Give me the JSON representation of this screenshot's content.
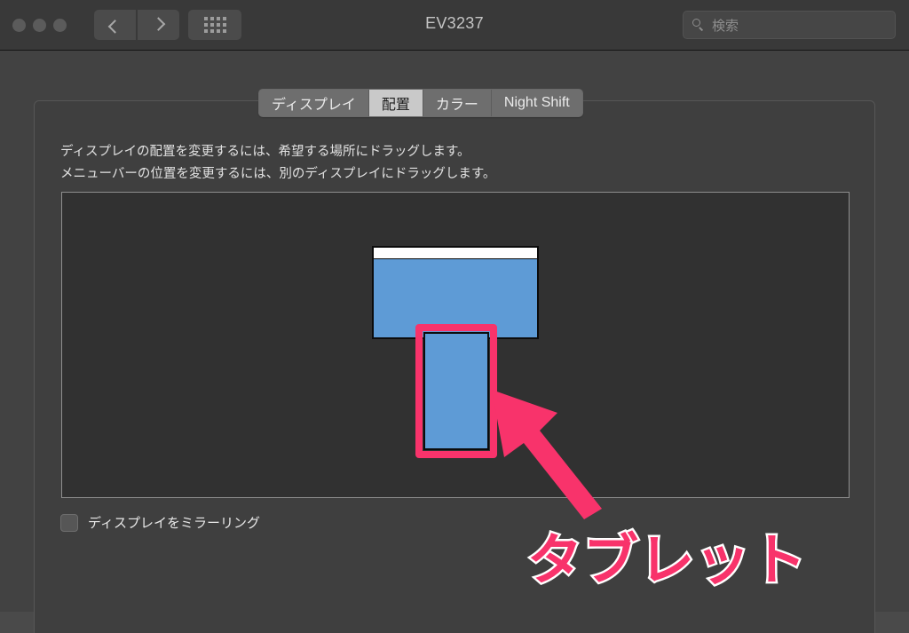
{
  "window": {
    "title": "EV3237",
    "traffic_lights": [
      "close",
      "minimize",
      "zoom"
    ]
  },
  "toolbar": {
    "back_icon": "chevron-left-icon",
    "forward_icon": "chevron-right-icon",
    "grid_icon": "grid-view-icon",
    "search": {
      "icon": "search-icon",
      "placeholder": "検索",
      "value": ""
    }
  },
  "tabs": [
    {
      "label": "ディスプレイ",
      "selected": false
    },
    {
      "label": "配置",
      "selected": true
    },
    {
      "label": "カラー",
      "selected": false
    },
    {
      "label": "Night Shift",
      "selected": false
    }
  ],
  "instructions": {
    "line1": "ディスプレイの配置を変更するには、希望する場所にドラッグします。",
    "line2": "メニューバーの位置を変更するには、別のディスプレイにドラッグします。"
  },
  "arrangement": {
    "displays": [
      {
        "name": "main-display",
        "has_menubar": true
      },
      {
        "name": "tablet-display",
        "has_menubar": false,
        "highlighted": true
      }
    ]
  },
  "mirror": {
    "label": "ディスプレイをミラーリング",
    "checked": false
  },
  "annotation": {
    "text": "タブレット",
    "arrow": "arrow-up-left",
    "color": "#f8336b",
    "outline_color": "#ffffff"
  },
  "colors": {
    "titlebar_bg": "#393939",
    "body_bg": "#424242",
    "panel_bg": "#3f3f3f",
    "arrange_bg": "#313131",
    "display_blue": "#5e9bd6",
    "accent_pink": "#f8336b",
    "tab_selected_bg": "#c9c9c9"
  }
}
